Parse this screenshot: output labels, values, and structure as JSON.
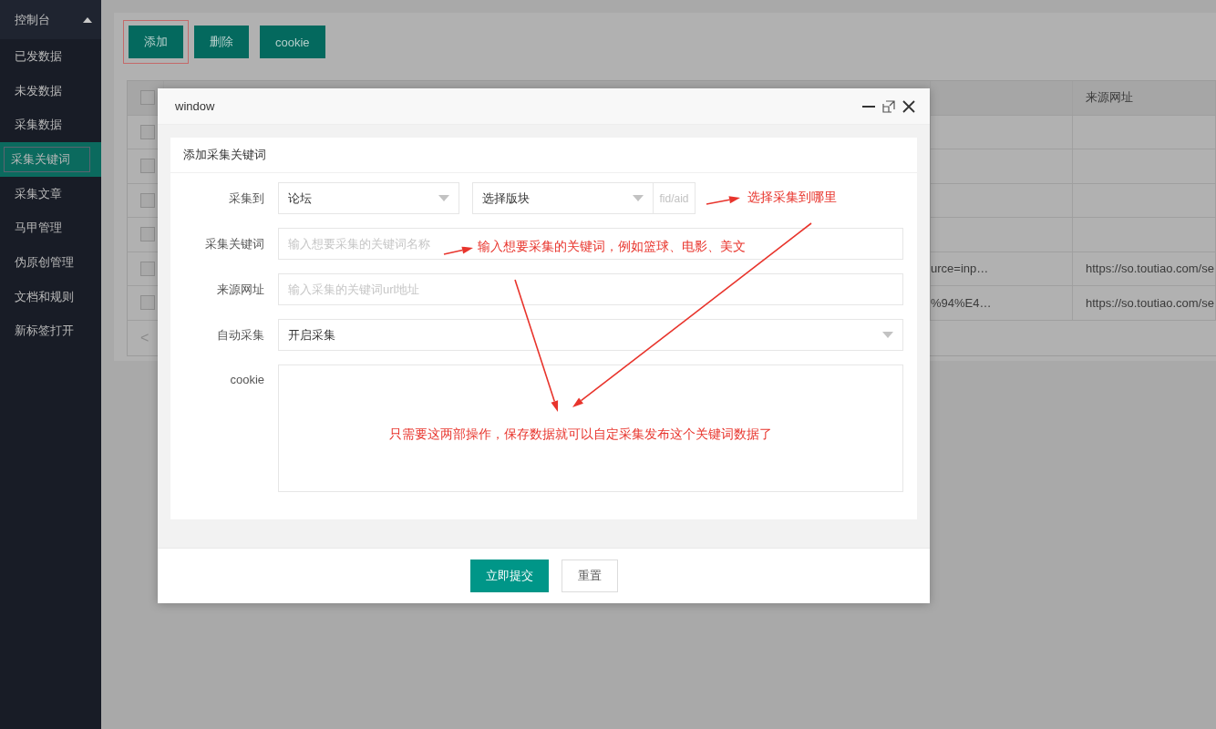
{
  "sidebar": {
    "header": "控制台",
    "expanded": true,
    "items": [
      {
        "label": "已发数据",
        "selected": false
      },
      {
        "label": "未发数据",
        "selected": false
      },
      {
        "label": "采集数据",
        "selected": false
      },
      {
        "label": "采集关键词",
        "selected": true
      },
      {
        "label": "采集文章",
        "selected": false
      },
      {
        "label": "马甲管理",
        "selected": false
      },
      {
        "label": "伪原创管理",
        "selected": false
      },
      {
        "label": "文档和规则",
        "selected": false
      },
      {
        "label": "新标签打开",
        "selected": false
      }
    ]
  },
  "toolbar": {
    "buttons": [
      {
        "label": "添加",
        "highlighted": true
      },
      {
        "label": "删除",
        "highlighted": false
      },
      {
        "label": "cookie",
        "highlighted": false
      }
    ]
  },
  "table": {
    "header_all_checked": false,
    "url_column": "来源网址",
    "rows": [
      {
        "checked": false
      },
      {
        "checked": false
      },
      {
        "checked": false
      },
      {
        "checked": false
      },
      {
        "checked": false,
        "column_2": "urce=inp…",
        "source_url": "https://so.toutiao.com/se"
      },
      {
        "checked": false,
        "column_2": "%94%E4…",
        "source_url": "https://so.toutiao.com/se"
      }
    ],
    "pager_prev": "<"
  },
  "modal": {
    "title": "window",
    "form_title": "添加采集关键词",
    "fields": [
      {
        "kind": "select_group",
        "label": "采集到",
        "value": "论坛",
        "value_2": "选择版块",
        "addon": "fid/aid"
      },
      {
        "kind": "input",
        "label": "采集关键词",
        "placeholder": "输入想要采集的关键词名称"
      },
      {
        "kind": "input",
        "label": "来源网址",
        "placeholder": "输入采集的关键词url地址"
      },
      {
        "kind": "select",
        "label": "自动采集",
        "value": "开启采集"
      },
      {
        "kind": "textarea",
        "label": "cookie"
      }
    ],
    "submit": "立即提交",
    "reset": "重置"
  },
  "annotations": {
    "target_note": "选择采集到哪里",
    "keyword_note": "输入想要采集的关键词，例如篮球、电影、美文",
    "summary_note": "只需要这两部操作，保存数据就可以自定采集发布这个关键词数据了"
  }
}
